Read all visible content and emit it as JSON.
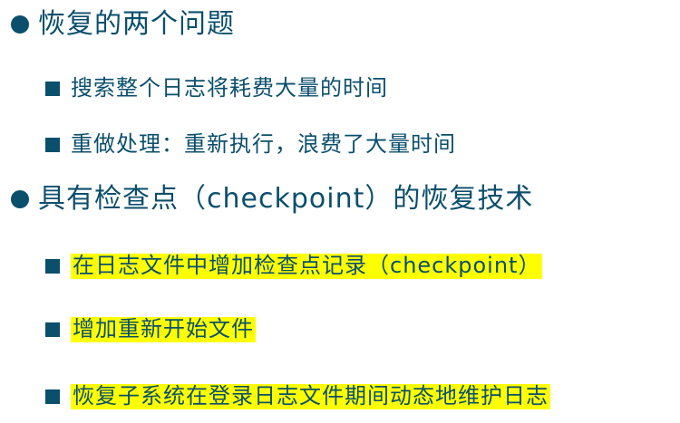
{
  "bullets": {
    "level1_icon": "circle-bullet",
    "level2_icon": "square-bullet",
    "color": "#0b4f6c",
    "highlight_color": "#ffff00"
  },
  "items": [
    {
      "level": 1,
      "text": "恢复的两个问题"
    },
    {
      "level": 2,
      "text": "搜索整个日志将耗费大量的时间"
    },
    {
      "level": 2,
      "text": "重做处理：重新执行，浪费了大量时间"
    },
    {
      "level": 1,
      "text": "具有检查点（checkpoint）的恢复技术"
    },
    {
      "level": 2,
      "text": "在日志文件中增加检查点记录（checkpoint）",
      "highlight": true
    },
    {
      "level": 2,
      "text": "增加重新开始文件",
      "highlight": true
    },
    {
      "level": 2,
      "text": "恢复子系统在登录日志文件期间动态地维护日志",
      "highlight": true
    }
  ]
}
